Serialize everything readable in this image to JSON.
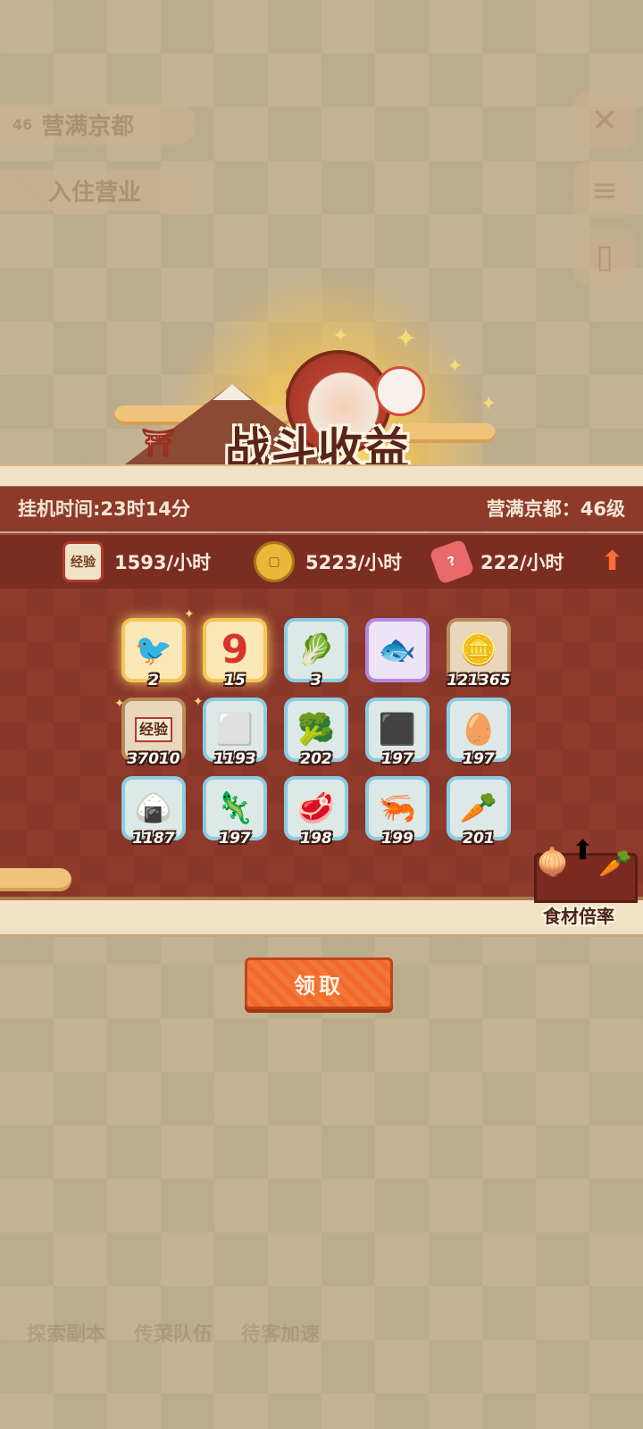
{
  "background": {
    "pill_top": "营满京都",
    "pill_top_icon": "46",
    "pill_second": "入住营业",
    "bottom_labels": [
      "探索副本",
      "传菜队伍",
      "待客加速"
    ]
  },
  "header": {
    "title": "战斗收益"
  },
  "info": {
    "idle_time": "挂机时间:23时14分",
    "level": "营满京都：46级"
  },
  "rates": [
    {
      "icon": "exp-scroll-icon",
      "label": "经验",
      "value": "1593/小时"
    },
    {
      "icon": "coin-icon",
      "label": "",
      "value": "5223/小时"
    },
    {
      "icon": "meat-ticket-icon",
      "label": "",
      "value": "222/小时"
    }
  ],
  "items": [
    {
      "name": "bird-icon",
      "glyph": "🐦",
      "count": "2",
      "frame": "gold"
    },
    {
      "name": "number-nine-icon",
      "glyph": "9",
      "count": "15",
      "frame": "gold"
    },
    {
      "name": "lettuce-icon",
      "glyph": "🥬",
      "count": "3",
      "frame": "teal"
    },
    {
      "name": "fish-icon",
      "glyph": "🐟",
      "count": "",
      "frame": "purple"
    },
    {
      "name": "coin-icon",
      "glyph": "🪙",
      "count": "121365",
      "frame": "brown"
    },
    {
      "name": "exp-scroll-icon",
      "glyph": "经验",
      "count": "37010",
      "frame": "brown"
    },
    {
      "name": "tofu-icon",
      "glyph": "⬜",
      "count": "1193",
      "frame": "teal"
    },
    {
      "name": "greens-icon",
      "glyph": "🥦",
      "count": "202",
      "frame": "teal"
    },
    {
      "name": "seaweed-icon",
      "glyph": "⬛",
      "count": "197",
      "frame": "teal"
    },
    {
      "name": "egg-icon",
      "glyph": "🥚",
      "count": "197",
      "frame": "teal"
    },
    {
      "name": "rice-icon",
      "glyph": "🍙",
      "count": "1187",
      "frame": "teal"
    },
    {
      "name": "eel-icon",
      "glyph": "🦎",
      "count": "197",
      "frame": "teal"
    },
    {
      "name": "meat-icon",
      "glyph": "🥩",
      "count": "198",
      "frame": "teal"
    },
    {
      "name": "shrimp-icon",
      "glyph": "🦐",
      "count": "199",
      "frame": "teal"
    },
    {
      "name": "radish-icon",
      "glyph": "🥕",
      "count": "201",
      "frame": "teal"
    }
  ],
  "multiplier": {
    "label": "食材倍率"
  },
  "claim_button": "领取",
  "colors": {
    "panel": "#8f3a2a",
    "accent": "#f26b2a",
    "info_bar": "#8e3a2b"
  }
}
